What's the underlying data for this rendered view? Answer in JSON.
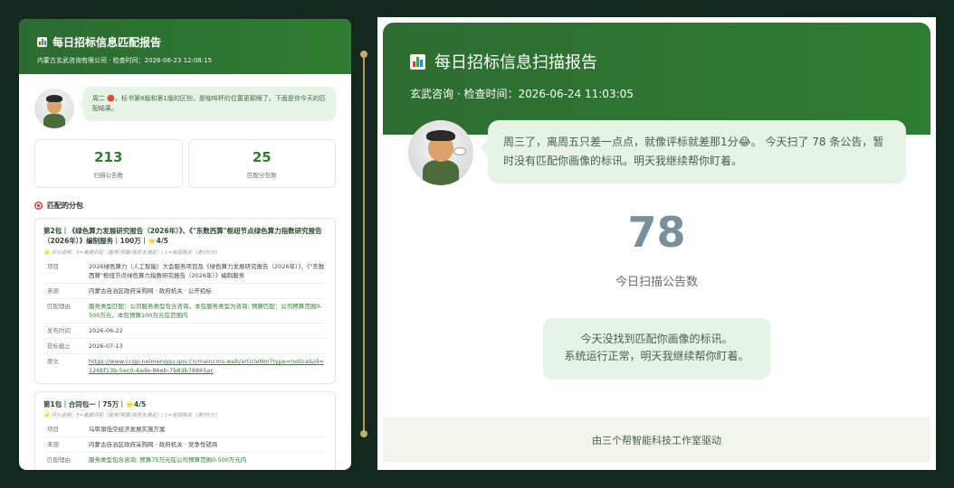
{
  "left": {
    "title": "每日招标信息匹配报告",
    "subtitle": "内蒙古玄武咨询有限公司 · 检查时间：2026-06-23 12:08:15",
    "greeting": "周二 🔴，标书第8版和第1版的区别，是咖啡杯的位置更颠眼了。下面是你今天的匹配结果。",
    "stats": [
      {
        "value": "213",
        "label": "扫描公告数"
      },
      {
        "value": "25",
        "label": "匹配分包数"
      }
    ],
    "section_title": "匹配的分包",
    "packages": [
      {
        "title": "第2包｜《绿色算力发展研究报告（2026年）》、《\"东数西算\"枢纽节点绿色算力指数研究报告（2026年）》编制服务｜100万｜⭐4/5",
        "note": "⭐ 评分说明：5=高度匹配（服务/预算/资质全满足）/ 1=极弱相关（满分5分）",
        "rows": [
          {
            "k": "项目",
            "v": "2026绿色算力（人工智能）大会服务项目及《绿色算力发展研究报告（2026年）》、《\"东数西算\"枢纽节点绿色算力指数研究报告（2026年）》编制服务",
            "style": ""
          },
          {
            "k": "来源",
            "v": "内蒙古自治区政府采购网 · 政府机关 · 公开招标",
            "style": ""
          },
          {
            "k": "匹配理由",
            "v": "服务类型匹配：公司服务类型包含咨询，本包服务类型为咨询; 预算匹配：公司预算范围0-500万元，本包预算100万元在范围内",
            "style": "green"
          },
          {
            "k": "发布时间",
            "v": "2026-06-22",
            "style": ""
          },
          {
            "k": "投标截止",
            "v": "2026-07-13",
            "style": ""
          },
          {
            "k": "原文",
            "v": "https://www.ccgp-neimenggu.gov.cn/maincms-web/articleNm?type=notice&id=126bf13b-5ec0-4ade-86eb-7b83b78865ac",
            "style": "link"
          }
        ]
      },
      {
        "title": "第1包｜合同包一｜75万｜⭐4/5",
        "note": "⭐ 评分说明：5=高度匹配（服务/预算/资质全满足）/ 1=极弱相关（满分5分）",
        "rows": [
          {
            "k": "项目",
            "v": "乌审旗低空经济发展实施方案",
            "style": ""
          },
          {
            "k": "来源",
            "v": "内蒙古自治区政府采购网 · 政府机关 · 竞争性磋商",
            "style": ""
          },
          {
            "k": "匹配理由",
            "v": "服务类型包含咨询; 预算75万元在公司预算范围0-500万元内",
            "style": "green"
          }
        ]
      }
    ]
  },
  "right": {
    "title": "每日招标信息扫描报告",
    "subtitle": "玄武咨询 · 检查时间：2026-06-24 11:03:05",
    "greeting": "周三了，离周五只差一点点，就像评标就差那1分😂。 今天扫了 78 条公告，暂时没有匹配你画像的标讯。明天我继续帮你盯着。",
    "big_number": "78",
    "big_label": "今日扫描公告数",
    "none_line1": "今天没找到匹配你画像的标讯。",
    "none_line2": "系统运行正常，明天我继续帮你盯着。",
    "footer": "由三个帮智能科技工作室驱动"
  },
  "icons": {
    "report": "bar-chart-icon",
    "section": "target-icon",
    "avatar": "mascot-avatar"
  },
  "colors": {
    "brand_green": "#2e7d32",
    "bubble_bg": "#e6f4e6",
    "divider_gold": "#b59a56",
    "big_number": "#78909c"
  }
}
